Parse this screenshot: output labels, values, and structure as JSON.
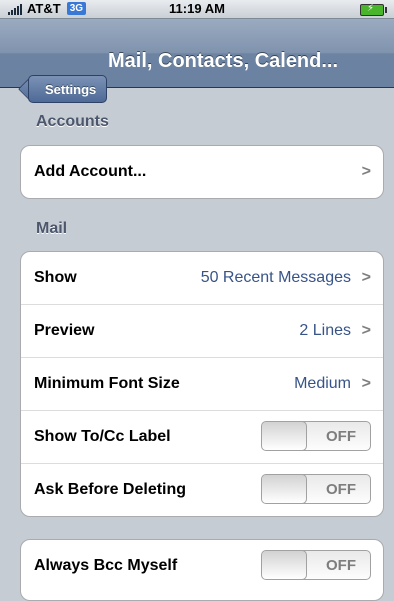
{
  "status_bar": {
    "carrier": "AT&T",
    "network": "3G",
    "time": "11:19 AM"
  },
  "nav": {
    "back_label": "Settings",
    "title": "Mail, Contacts, Calend..."
  },
  "sections": {
    "accounts_header": "Accounts",
    "mail_header": "Mail"
  },
  "accounts": {
    "add_account": "Add Account..."
  },
  "mail": {
    "show": {
      "label": "Show",
      "value": "50 Recent Messages"
    },
    "preview": {
      "label": "Preview",
      "value": "2 Lines"
    },
    "min_font": {
      "label": "Minimum Font Size",
      "value": "Medium"
    },
    "show_tocc": {
      "label": "Show To/Cc Label",
      "state": "OFF"
    },
    "ask_delete": {
      "label": "Ask Before Deleting",
      "state": "OFF"
    }
  },
  "bcc": {
    "always_bcc": {
      "label": "Always Bcc Myself",
      "state": "OFF"
    }
  },
  "icons": {
    "chevron": "chevron-right-icon",
    "battery": "battery-charging-icon",
    "signal": "signal-strength-icon"
  },
  "colors": {
    "nav_bar": "#6d83a2",
    "background": "#c5ccd4",
    "value_text": "#385487",
    "battery": "#49b52a",
    "network_badge": "#3a78d6"
  }
}
